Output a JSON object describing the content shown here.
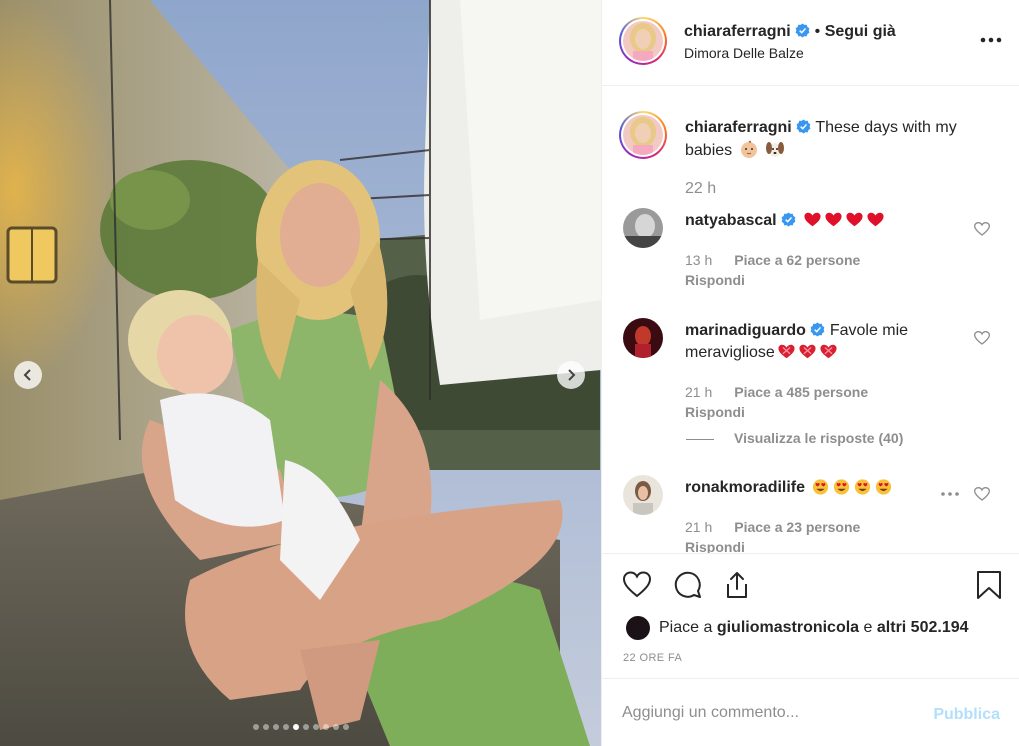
{
  "post": {
    "username": "chiaraferragni",
    "follow_status": "Segui già",
    "separator": "•",
    "location": "Dimora Delle Balze",
    "caption": "These days with my babies",
    "caption_time": "22 h"
  },
  "carousel": {
    "slide_count": 10,
    "active_index": 4
  },
  "comments": [
    {
      "username": "natyabascal",
      "verified": true,
      "text": "",
      "emoji": [
        "red-heart",
        "red-heart",
        "red-heart",
        "red-heart"
      ],
      "time": "13 h",
      "likes": "Piace a 62 persone",
      "reply": "Rispondi"
    },
    {
      "username": "marinadiguardo",
      "verified": true,
      "text": "Favole mie meravigliose",
      "emoji": [
        "heart-with-ribbon",
        "heart-with-ribbon",
        "heart-with-ribbon"
      ],
      "time": "21 h",
      "likes": "Piace a 485 persone",
      "reply": "Rispondi",
      "view_replies": "Visualizza le risposte (40)"
    },
    {
      "username": "ronakmoradilife",
      "verified": false,
      "text": "",
      "emoji": [
        "heart-eyes",
        "heart-eyes",
        "heart-eyes",
        "heart-eyes"
      ],
      "time": "21 h",
      "likes": "Piace a 23 persone",
      "reply": "Rispondi"
    }
  ],
  "liked_by": {
    "prefix": "Piace a",
    "user": "giuliomastronicola",
    "middle": "e",
    "rest": "altri 502.194"
  },
  "timestamp": "22 ORE FA",
  "add_comment": {
    "placeholder": "Aggiungi un commento...",
    "publish": "Pubblica"
  },
  "colors": {
    "verified": "#3897f0",
    "publish_disabled": "#b2dffc",
    "muted": "#8e8e8e"
  },
  "icons": [
    "more-icon",
    "like-icon",
    "comment-icon",
    "share-icon",
    "save-icon",
    "chevron-left-icon",
    "chevron-right-icon"
  ]
}
